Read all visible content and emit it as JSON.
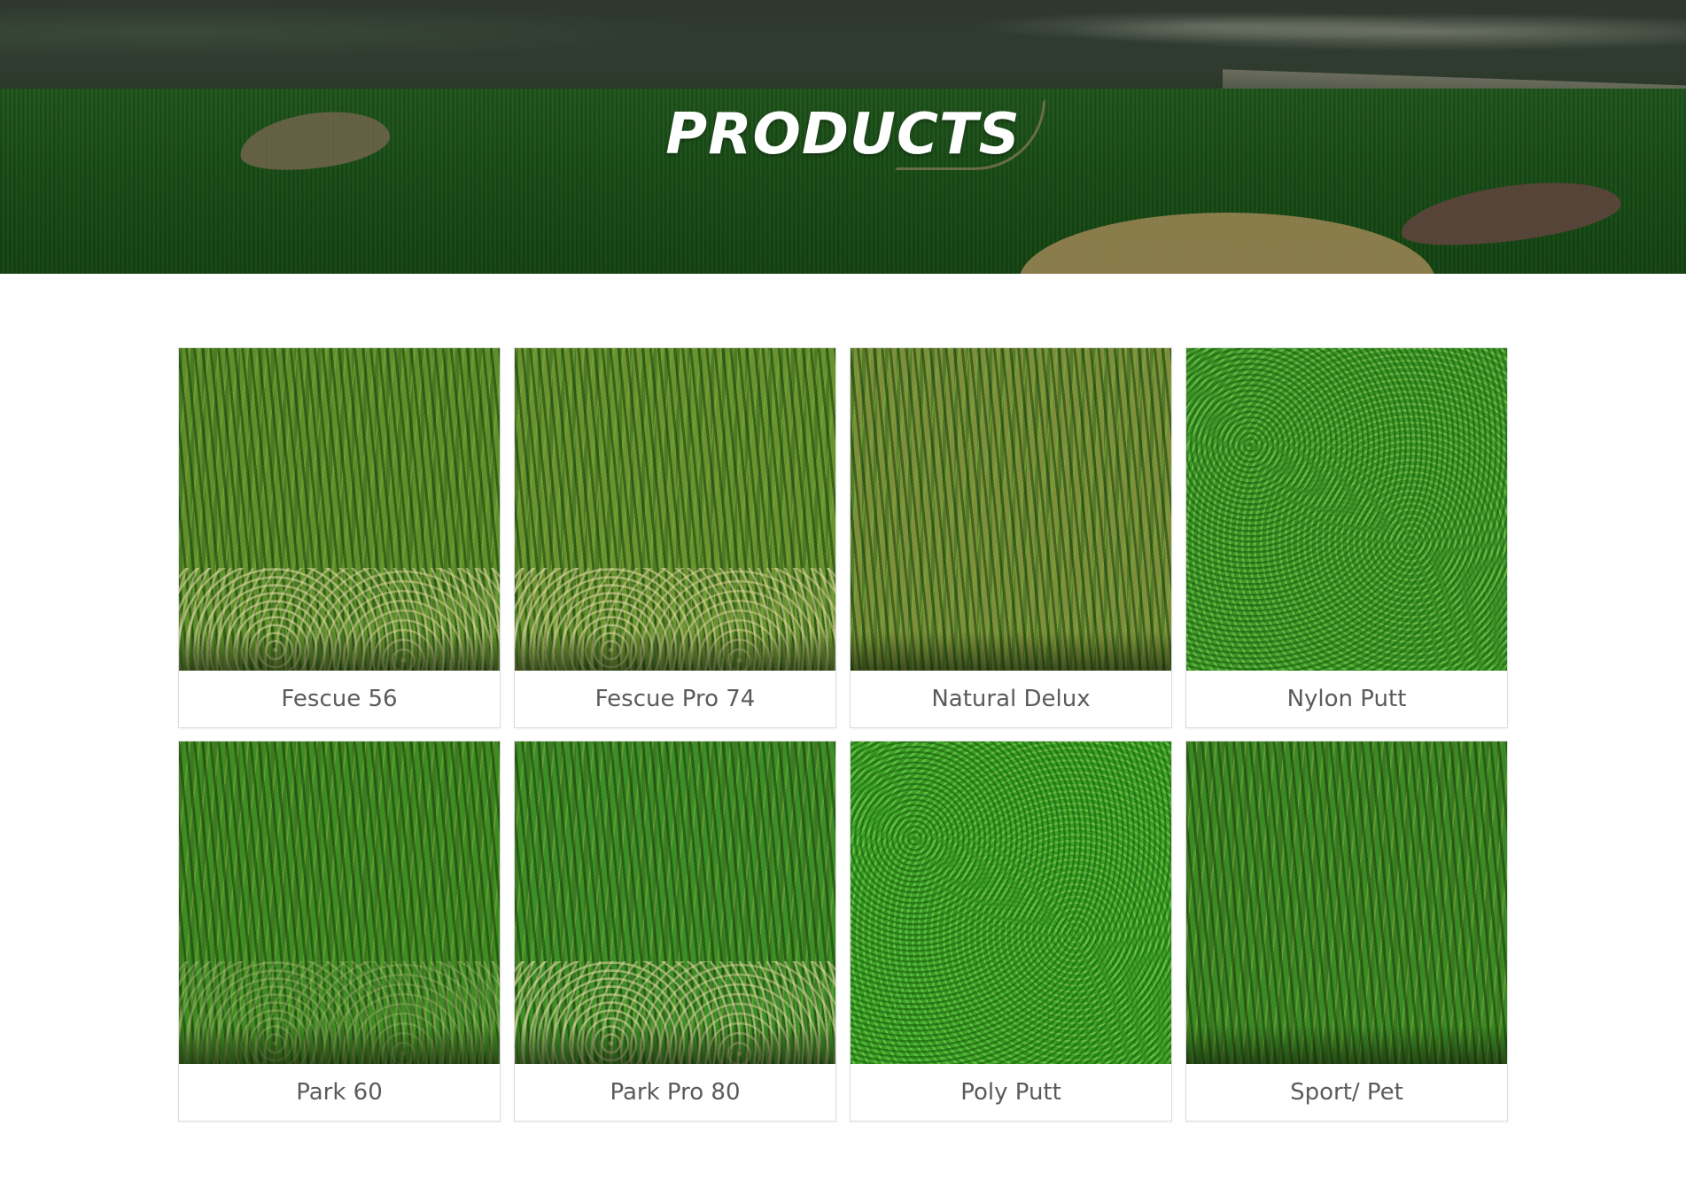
{
  "hero": {
    "title": "PRODUCTS"
  },
  "products": [
    {
      "name": "Fescue 56",
      "image": "grass-sample-image"
    },
    {
      "name": "Fescue Pro 74",
      "image": "grass-sample-image"
    },
    {
      "name": "Natural Delux",
      "image": "grass-sample-image"
    },
    {
      "name": "Nylon Putt",
      "image": "grass-sample-image"
    },
    {
      "name": "Park 60",
      "image": "grass-sample-image"
    },
    {
      "name": "Park Pro 80",
      "image": "grass-sample-image"
    },
    {
      "name": "Poly Putt",
      "image": "grass-sample-image"
    },
    {
      "name": "Sport/ Pet",
      "image": "grass-sample-image"
    }
  ],
  "colors": {
    "label_text": "#5b5b5b",
    "card_border": "#dcdcdc",
    "hero_title": "#ffffff"
  }
}
